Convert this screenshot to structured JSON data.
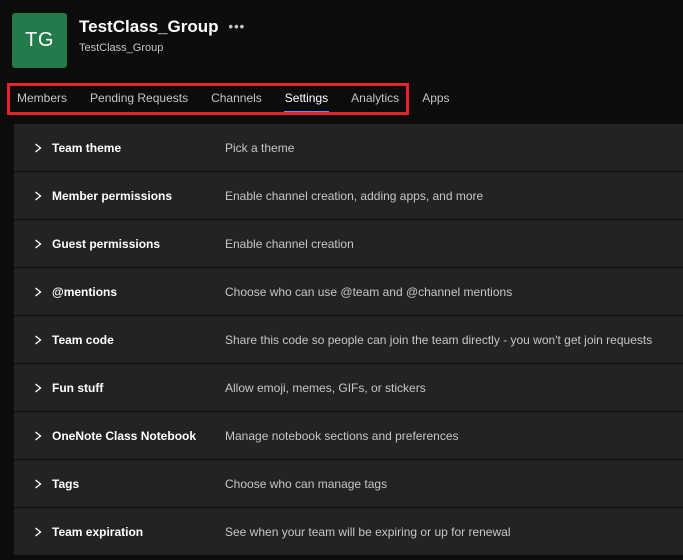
{
  "header": {
    "avatar_initials": "TG",
    "title": "TestClass_Group",
    "more_label": "•••",
    "subtitle": "TestClass_Group"
  },
  "tabs": [
    {
      "label": "Members",
      "active": false
    },
    {
      "label": "Pending Requests",
      "active": false
    },
    {
      "label": "Channels",
      "active": false
    },
    {
      "label": "Settings",
      "active": true
    },
    {
      "label": "Analytics",
      "active": false
    },
    {
      "label": "Apps",
      "active": false
    }
  ],
  "rows": [
    {
      "label": "Team theme",
      "description": "Pick a theme"
    },
    {
      "label": "Member permissions",
      "description": "Enable channel creation, adding apps, and more"
    },
    {
      "label": "Guest permissions",
      "description": "Enable channel creation"
    },
    {
      "label": "@mentions",
      "description": "Choose who can use @team and @channel mentions"
    },
    {
      "label": "Team code",
      "description": "Share this code so people can join the team directly - you won't get join requests"
    },
    {
      "label": "Fun stuff",
      "description": "Allow emoji, memes, GIFs, or stickers"
    },
    {
      "label": "OneNote Class Notebook",
      "description": "Manage notebook sections and preferences"
    },
    {
      "label": "Tags",
      "description": "Choose who can manage tags"
    },
    {
      "label": "Team expiration",
      "description": "See when your team will be expiring or up for renewal"
    }
  ],
  "colors": {
    "avatar_bg": "#237b4b",
    "active_tab_underline": "#7f85f5",
    "annotation_red": "#e8212b",
    "row_bg": "#242323",
    "page_bg": "#0c0c0c",
    "secondary_text": "#c8c6c4"
  }
}
